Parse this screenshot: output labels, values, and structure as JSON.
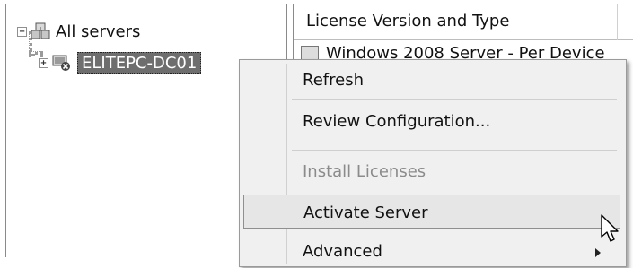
{
  "tree": {
    "root": {
      "label": "All servers",
      "expander": "−",
      "icon": "server-group-icon"
    },
    "child": {
      "label": "ELITEPC-DC01",
      "expander": "+",
      "icon": "server-error-icon"
    }
  },
  "list": {
    "column_header": "License Version and Type",
    "partial_row": "Windows 2008 Server - Per Device"
  },
  "context_menu": {
    "items": [
      {
        "label": "Refresh",
        "state": "normal"
      },
      {
        "label": "Review Configuration...",
        "state": "normal"
      },
      {
        "label": "Install Licenses",
        "state": "disabled"
      },
      {
        "label": "Activate Server",
        "state": "highlighted"
      },
      {
        "label": "Advanced",
        "state": "submenu"
      }
    ]
  },
  "colors": {
    "selection": "#6e6e6e",
    "menu_bg": "#f0f0f0",
    "highlight": "#e6e6e6",
    "disabled_text": "#8b8b8b"
  }
}
